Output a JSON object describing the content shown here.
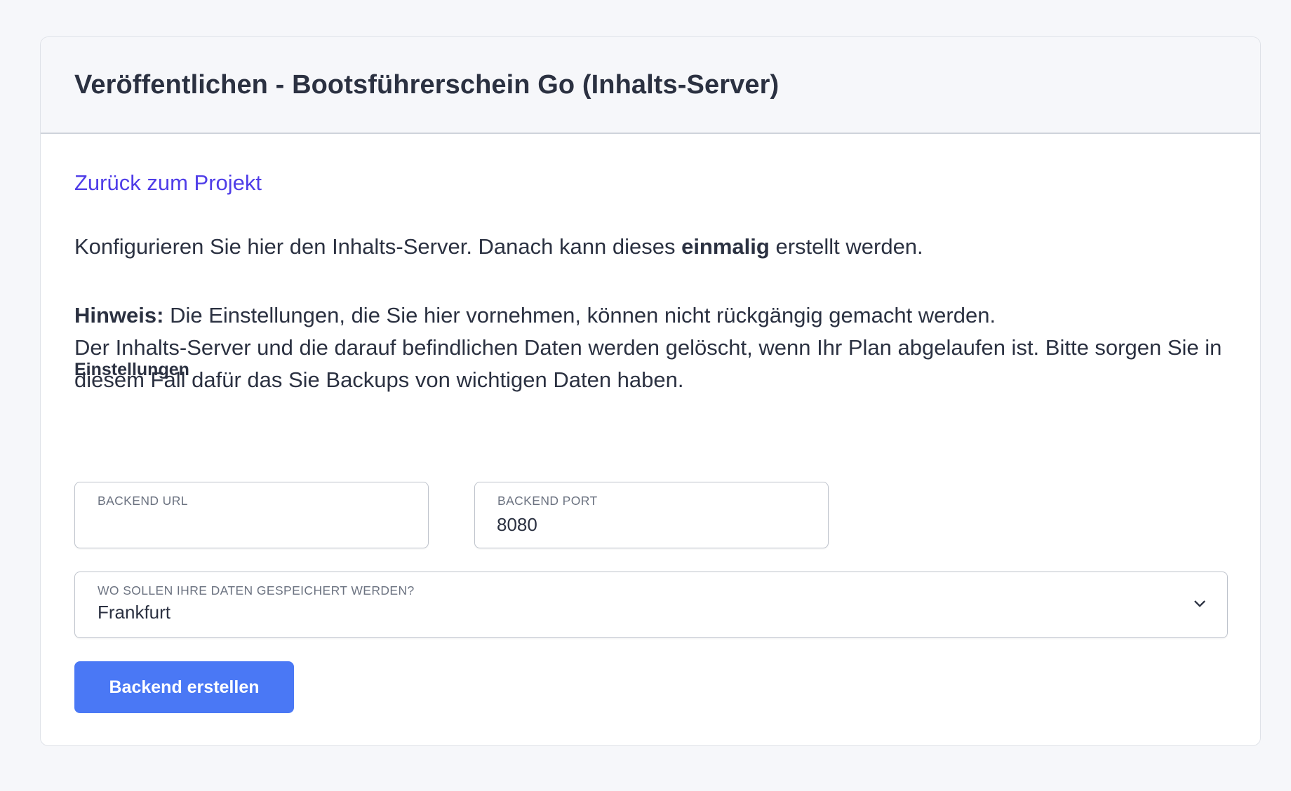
{
  "header": {
    "title": "Veröffentlichen - Bootsführerschein Go (Inhalts-Server)"
  },
  "back_link": "Zurück zum Projekt",
  "intro": {
    "before": "Konfigurieren Sie hier den Inhalts-Server. Danach kann dieses ",
    "emphasis": "einmalig",
    "after": " erstellt werden."
  },
  "notice": {
    "label": "Hinweis:",
    "line1": " Die Einstellungen, die Sie hier vornehmen, können nicht rückgängig gemacht werden.",
    "line2": "Der Inhalts-Server und die darauf befindlichen Daten werden gelöscht, wenn Ihr Plan abgelaufen ist. Bitte sorgen Sie in diesem Fall dafür das Sie Backups von wichtigen Daten haben."
  },
  "settings": {
    "section_label": "Einstellungen",
    "backend_url": {
      "label": "BACKEND URL",
      "value": ""
    },
    "backend_port": {
      "label": "BACKEND PORT",
      "value": "8080"
    },
    "location": {
      "label": "WO SOLLEN IHRE DATEN GESPEICHERT WERDEN?",
      "value": "Frankfurt",
      "icon": "chevron-down-icon"
    }
  },
  "submit_label": "Backend erstellen",
  "colors": {
    "link": "#4f3de8",
    "button": "#4a78f5",
    "background": "#f6f7fa"
  }
}
